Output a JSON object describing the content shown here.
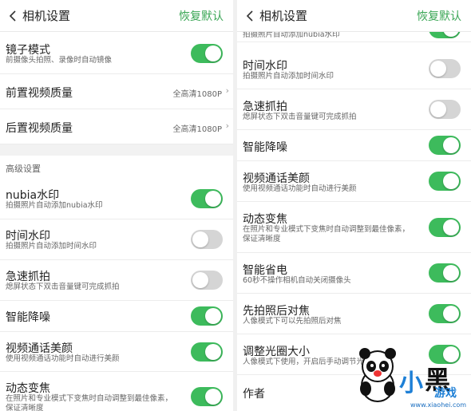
{
  "left": {
    "header": {
      "title": "相机设置",
      "action": "恢复默认"
    },
    "rows": [
      {
        "title": "镜子模式",
        "desc": "前摄像头拍照、录像时自动镜像",
        "toggle": true
      },
      {
        "title": "前置视频质量",
        "value": "全高清1080P"
      },
      {
        "title": "后置视频质量",
        "value": "全高清1080P"
      }
    ],
    "section_title": "高级设置",
    "advanced": [
      {
        "title": "nubia水印",
        "desc": "拍摄照片自动添加nubia水印",
        "toggle": true
      },
      {
        "title": "时间水印",
        "desc": "拍摄照片自动添加时间水印",
        "toggle": false
      },
      {
        "title": "急速抓拍",
        "desc": "熄屏状态下双击音量键可完成抓拍",
        "toggle": false
      },
      {
        "title": "智能降噪",
        "toggle": true
      },
      {
        "title": "视频通话美颜",
        "desc": "使用视频通话功能时自动进行美颜",
        "toggle": true
      },
      {
        "title": "动态变焦",
        "desc": "在照片和专业模式下变焦时自动调整到最佳像素，",
        "desc2": "保证清晰度",
        "toggle": true
      }
    ]
  },
  "right": {
    "header": {
      "title": "相机设置",
      "action": "恢复默认"
    },
    "partial_desc": "拍摄照片自动添加nubia水印",
    "rows": [
      {
        "title": "时间水印",
        "desc": "拍摄照片自动添加时间水印",
        "toggle": false
      },
      {
        "title": "急速抓拍",
        "desc": "熄屏状态下双击音量键可完成抓拍",
        "toggle": false
      },
      {
        "title": "智能降噪",
        "toggle": true
      },
      {
        "title": "视频通话美颜",
        "desc": "使用视频通话功能时自动进行美颜",
        "toggle": true
      },
      {
        "title": "动态变焦",
        "desc": "在照片和专业模式下变焦时自动调整到最佳像素，",
        "desc2": "保证清晰度",
        "toggle": true
      },
      {
        "title": "智能省电",
        "desc": "60秒不操作相机自动关闭摄像头",
        "toggle": true
      },
      {
        "title": "先拍照后对焦",
        "desc": "人像模式下可以先拍照后对焦",
        "toggle": true
      },
      {
        "title": "调整光圈大小",
        "desc": "人像模式下使用，开启后手动调节光圈范围",
        "toggle": true
      },
      {
        "title": "作者"
      }
    ]
  },
  "watermark": {
    "brand_1": "小",
    "brand_2": "黑",
    "brand_3": "游戏",
    "url": "www.xiaohei.com"
  },
  "colors": {
    "accent": "#3aa655",
    "toggle_on": "#3dbb5c",
    "toggle_off": "#d5d5d5"
  }
}
